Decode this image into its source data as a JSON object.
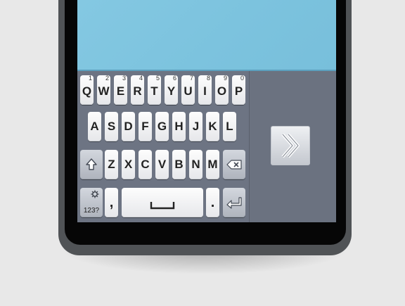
{
  "keyboard": {
    "row1": [
      {
        "key": "Q",
        "num": "1"
      },
      {
        "key": "W",
        "num": "2"
      },
      {
        "key": "E",
        "num": "3"
      },
      {
        "key": "R",
        "num": "4"
      },
      {
        "key": "T",
        "num": "5"
      },
      {
        "key": "Y",
        "num": "6"
      },
      {
        "key": "U",
        "num": "7"
      },
      {
        "key": "I",
        "num": "8"
      },
      {
        "key": "O",
        "num": "9"
      },
      {
        "key": "P",
        "num": "0"
      }
    ],
    "row2": [
      "A",
      "S",
      "D",
      "F",
      "G",
      "H",
      "J",
      "K",
      "L"
    ],
    "row3": [
      "Z",
      "X",
      "C",
      "V",
      "B",
      "N",
      "M"
    ],
    "comma": ",",
    "period": ".",
    "symbols_label": "123?",
    "icons": {
      "shift": "shift-arrow-icon",
      "backspace": "backspace-icon",
      "settings": "gear-icon",
      "space": "space-bracket-icon",
      "enter": "enter-return-icon"
    }
  },
  "panel": {
    "next_icon": "double-chevron-right-icon"
  },
  "colors": {
    "screen_content": "#7cc3de",
    "keyboard_bg": "#6d7483",
    "key_light": "#f2f3f5",
    "key_dark": "#bfc3cb"
  }
}
